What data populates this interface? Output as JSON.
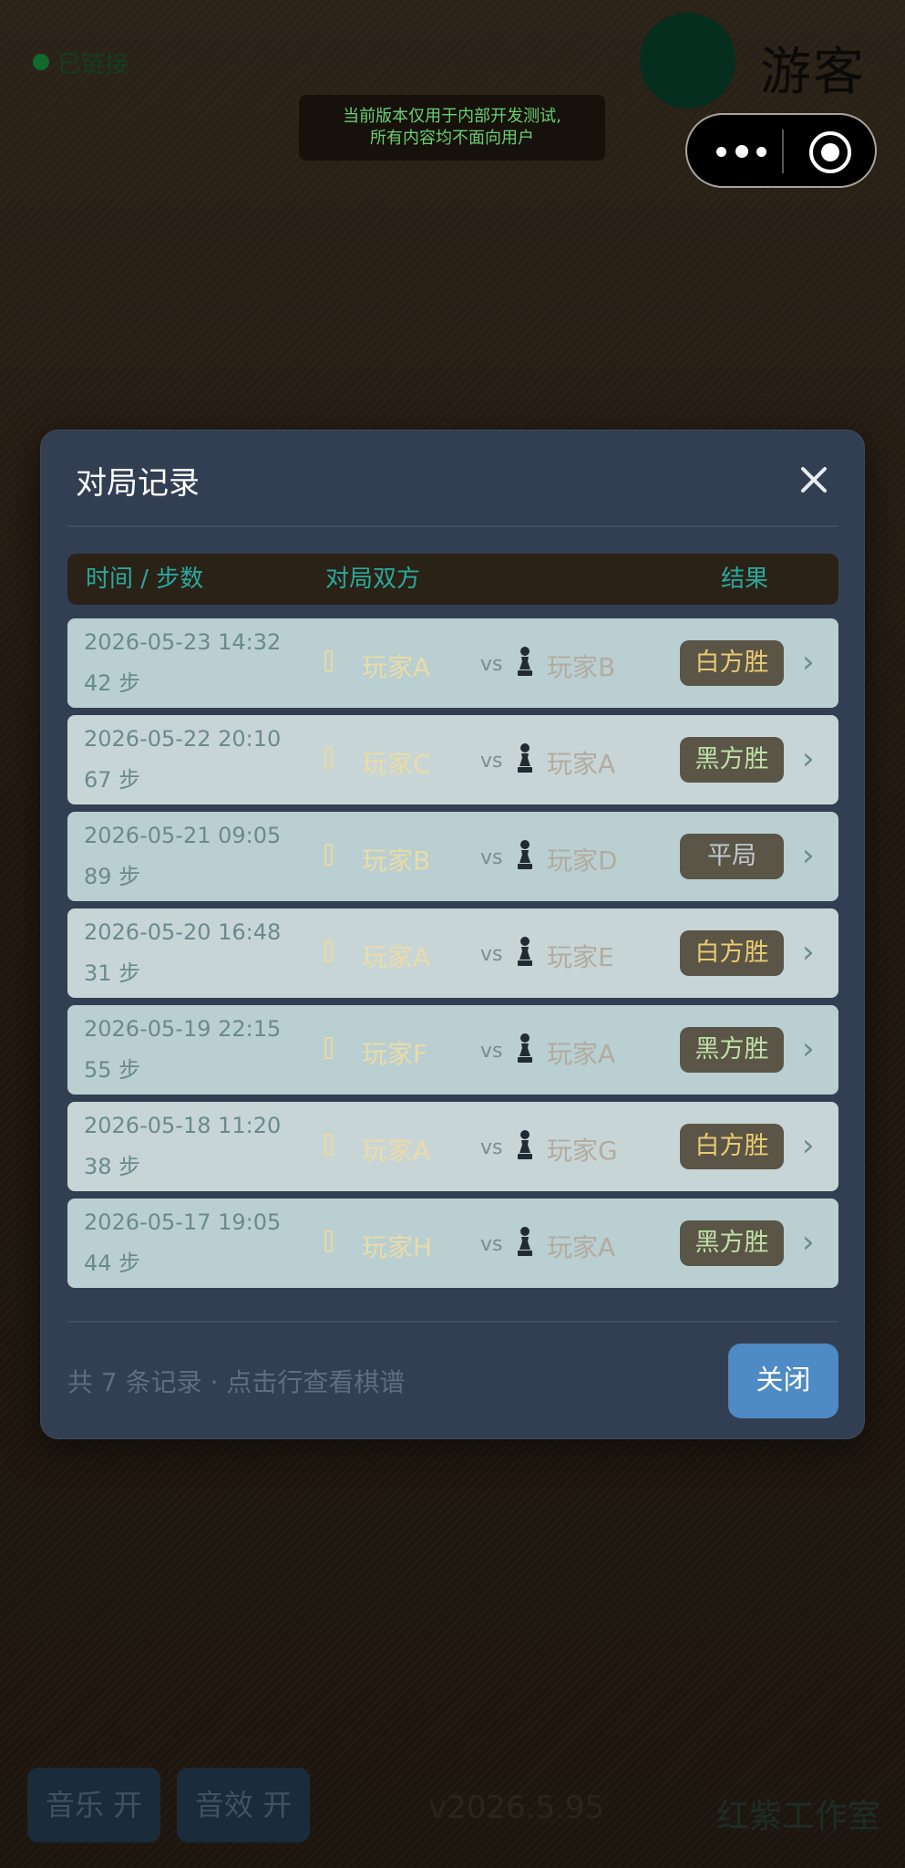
{
  "status": {
    "text": "已链接"
  },
  "user": {
    "name": "游客"
  },
  "notice": {
    "line1": "当前版本仅用于内部开发测试,",
    "line2": "所有内容均不面向用户"
  },
  "capsule": {
    "more_icon": "more-icon",
    "target_icon": "target-icon"
  },
  "modal": {
    "title": "对局记录",
    "columns": {
      "time": "时间 / 步数",
      "players": "对局双方",
      "result": "结果"
    },
    "records": [
      {
        "date": "2026-05-23 14:32",
        "steps": "42 步",
        "white": "玩家A",
        "vs": "vs",
        "black": "玩家B",
        "result": "白方胜",
        "result_color": "#eacb71"
      },
      {
        "date": "2026-05-22 20:10",
        "steps": "67 步",
        "white": "玩家C",
        "vs": "vs",
        "black": "玩家A",
        "result": "黑方胜",
        "result_color": "#bfe0a6"
      },
      {
        "date": "2026-05-21 09:05",
        "steps": "89 步",
        "white": "玩家B",
        "vs": "vs",
        "black": "玩家D",
        "result": "平局",
        "result_color": "#c2c8cc"
      },
      {
        "date": "2026-05-20 16:48",
        "steps": "31 步",
        "white": "玩家A",
        "vs": "vs",
        "black": "玩家E",
        "result": "白方胜",
        "result_color": "#eacb71"
      },
      {
        "date": "2026-05-19 22:15",
        "steps": "55 步",
        "white": "玩家F",
        "vs": "vs",
        "black": "玩家A",
        "result": "黑方胜",
        "result_color": "#bfe0a6"
      },
      {
        "date": "2026-05-18 11:20",
        "steps": "38 步",
        "white": "玩家A",
        "vs": "vs",
        "black": "玩家G",
        "result": "白方胜",
        "result_color": "#eacb71"
      },
      {
        "date": "2026-05-17 19:05",
        "steps": "44 步",
        "white": "玩家H",
        "vs": "vs",
        "black": "玩家A",
        "result": "黑方胜",
        "result_color": "#bfe0a6"
      }
    ],
    "footer": {
      "summary": "共 7 条记录 · 点击行查看棋谱",
      "close": "关闭"
    }
  },
  "bottom": {
    "music": "音乐 开",
    "sound": "音效 开",
    "version": "v2026.5.95",
    "studio": "红紫工作室"
  },
  "colors": {
    "accent": "#2aa89e",
    "modal_bg": "#323f52",
    "close_button": "#4e8ac4"
  }
}
